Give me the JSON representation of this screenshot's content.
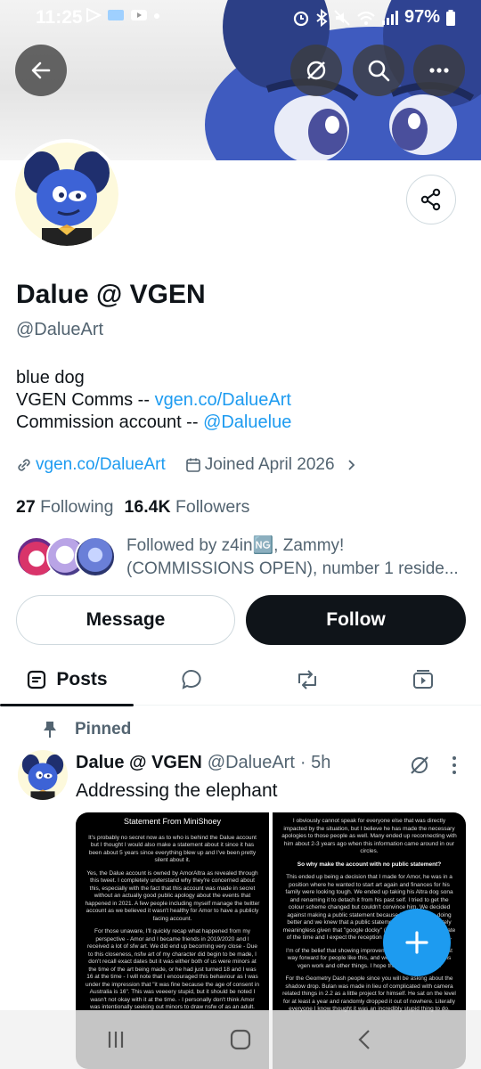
{
  "status_bar": {
    "time": "11:25",
    "battery": "97%"
  },
  "header": {
    "back_label": "Back",
    "more_icon": "more-icon"
  },
  "profile": {
    "display_name": "Dalue @ VGEN",
    "handle": "@DalueArt",
    "bio_line1": "blue dog",
    "bio_line2_prefix": "VGEN Comms -- ",
    "bio_line2_link": "vgen.co/DalueArt",
    "bio_line3_prefix": "Commission account -- ",
    "bio_line3_link": "@Daluelue",
    "website": "vgen.co/DalueArt",
    "joined": "Joined April 2026",
    "following_count": "27",
    "following_label": "Following",
    "followers_count": "16.4K",
    "followers_label": "Followers",
    "followed_by_line1": "Followed by z4in🆖, Zammy!",
    "followed_by_line2": "(COMMISSIONS OPEN), number 1 reside..."
  },
  "actions": {
    "message_label": "Message",
    "follow_label": "Follow"
  },
  "tabs": {
    "posts_label": "Posts"
  },
  "pinned_post": {
    "pinned_label": "Pinned",
    "author_name": "Dalue @ VGEN",
    "author_handle": "@DalueArt",
    "time": "· 5h",
    "text": "Addressing the elephant",
    "image1_title": "Statement From MiniShoey",
    "image1_para1": "It's probably no secret now as to who is behind the Dalue account but I thought I would also make a statement about it since it has been about 5 years since everything blew up and I've been pretty silent about it.",
    "image1_para2": "Yes, the Dalue account is owned by AmorAltra as revealed through this tweet. I completely understand why they're concerned about this, especially with the fact that this account was made in secret without an actually good public apology about the events that happened in 2021. A few people including myself manage the twitter account as we believed it wasn't healthy for Amor to have a publicly facing account.",
    "image1_para3": "For those unaware, I'll quickly recap what happened from my perspective - Amor and I became friends in 2019/2020 and I received a lot of sfw art. We did end up becoming very close - Due to this closeness, nsfw art of my character did begin to be made, I don't recall exact dates but it was either both of us were minors at the time of the art being made, or he had just turned 18 and I was 16 at the time - I will note that I encouraged this behaviour as I was under the impression that \"it was fine because the age of consent in Australia is 16\". This was veeeery stupid, but it should be noted I wasn't not okay with it at the time. - I personally don't think Amor was intentionally seeking out minors to draw nsfw of as an adult.",
    "image2_para1": "I obviously cannot speak for everyone else that was directly impacted by the situation, but I believe he has made the necessary apologies to those people as well. Many ended up reconnecting with him about 2-3 years ago when this information came around in our circles.",
    "image2_sub": "So why make the account with no public statement?",
    "image2_para2": "This ended up being a decision that I made for Amor, he was in a position where he wanted to start art again and finances for his family were looking tough. We ended up taking his Altra dog sona and renaming it to detach it from his past self. I tried to get the colour scheme changed but couldn't convince him. We decided against making a public statement because he felt he was doing better and we knew that a public statement would be completely meaningless given that \"google docky\" (ironic I know) was the state of the time and I expect the reception to this to be a similar case.",
    "image2_para3": "I'm of the belief that showing improvement and growth is the best way forward for people like this, and we have seen that with this vgen work and other things. I hope that speaks for itself.",
    "image2_para4": "For the Geometry Dash people since you will be asking about the shadow drop. Bulan was made in lieu of complicated with camera related things in 2.2 as a little project for himself. He sat on the level for at least a year and randomly dropped it out of nowhere. Literally everyone I know thought it was an incredibly stupid thing to do."
  },
  "nav": {
    "recents_icon": "recents-icon",
    "home_icon": "home-icon",
    "back_icon": "nav-back-icon"
  }
}
